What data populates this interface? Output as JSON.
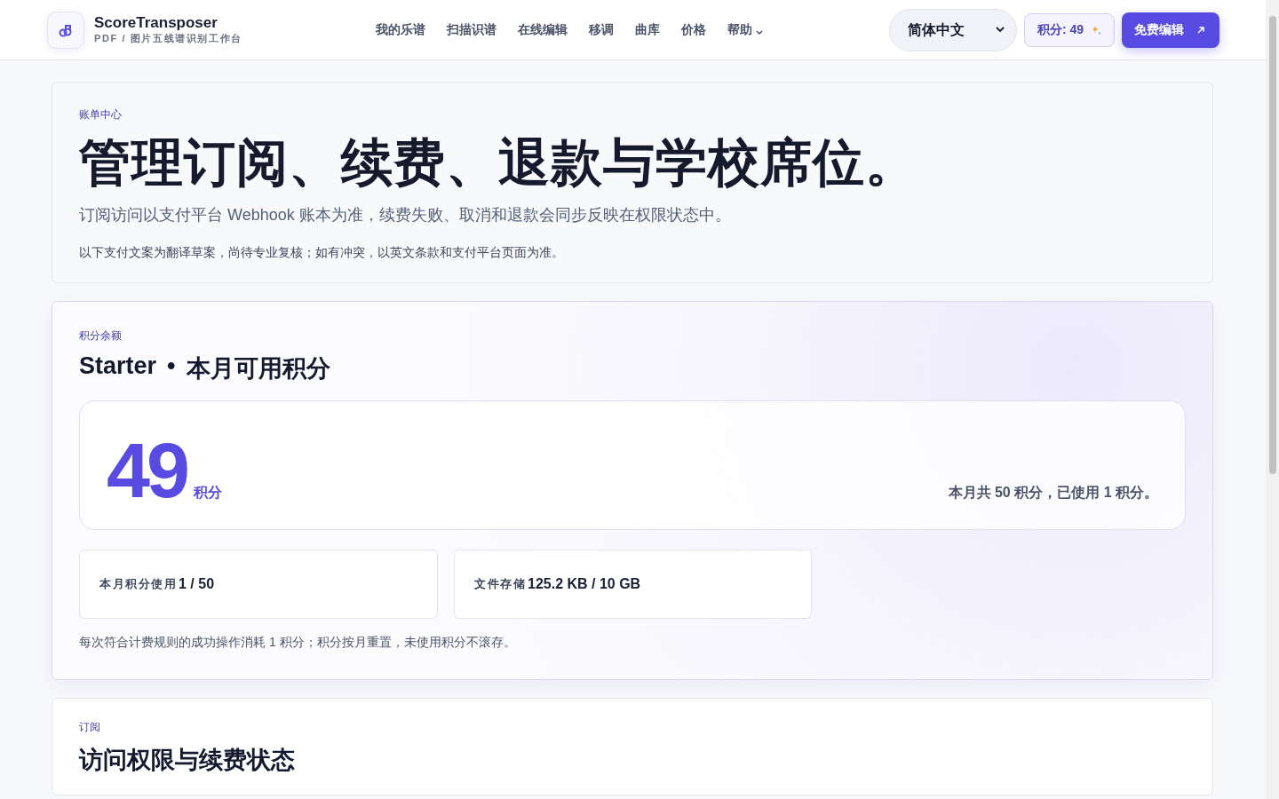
{
  "header": {
    "brand": {
      "name": "ScoreTransposer",
      "tagline": "PDF / 图片五线谱识别工作台"
    },
    "nav": [
      {
        "label": "我的乐谱",
        "kind": "link"
      },
      {
        "label": "扫描识谱",
        "kind": "link"
      },
      {
        "label": "在线编辑",
        "kind": "link"
      },
      {
        "label": "移调",
        "kind": "link"
      },
      {
        "label": "曲库",
        "kind": "link"
      },
      {
        "label": "价格",
        "kind": "link"
      },
      {
        "label": "帮助",
        "kind": "dropdown"
      }
    ],
    "language_select": {
      "value": "简体中文"
    },
    "credits_badge": {
      "label": "积分: 49"
    },
    "cta_button": {
      "label": "免费编辑"
    }
  },
  "billing_intro": {
    "eyebrow": "账单中心",
    "title": "管理订阅、续费、退款与学校席位。",
    "subtitle": "订阅访问以支付平台 Webhook 账本为准，续费失败、取消和退款会同步反映在权限状态中。",
    "note": "以下支付文案为翻译草案，尚待专业复核；如有冲突，以英文条款和支付平台页面为准。"
  },
  "credits": {
    "eyebrow": "积分余额",
    "plan": "Starter",
    "separator": "•",
    "title": "本月可用积分",
    "balance": "49",
    "unit": "积分",
    "summary": "本月共 50 积分，已使用 1 积分。",
    "stats": [
      {
        "label": "本月积分使用",
        "value": "1 / 50"
      },
      {
        "label": "文件存储",
        "value": "125.2 KB / 10 GB"
      }
    ],
    "note": "每次符合计费规则的成功操作消耗 1 积分；积分按月重置，未使用积分不滚存。"
  },
  "subscription": {
    "eyebrow": "订阅",
    "title": "访问权限与续费状态"
  }
}
